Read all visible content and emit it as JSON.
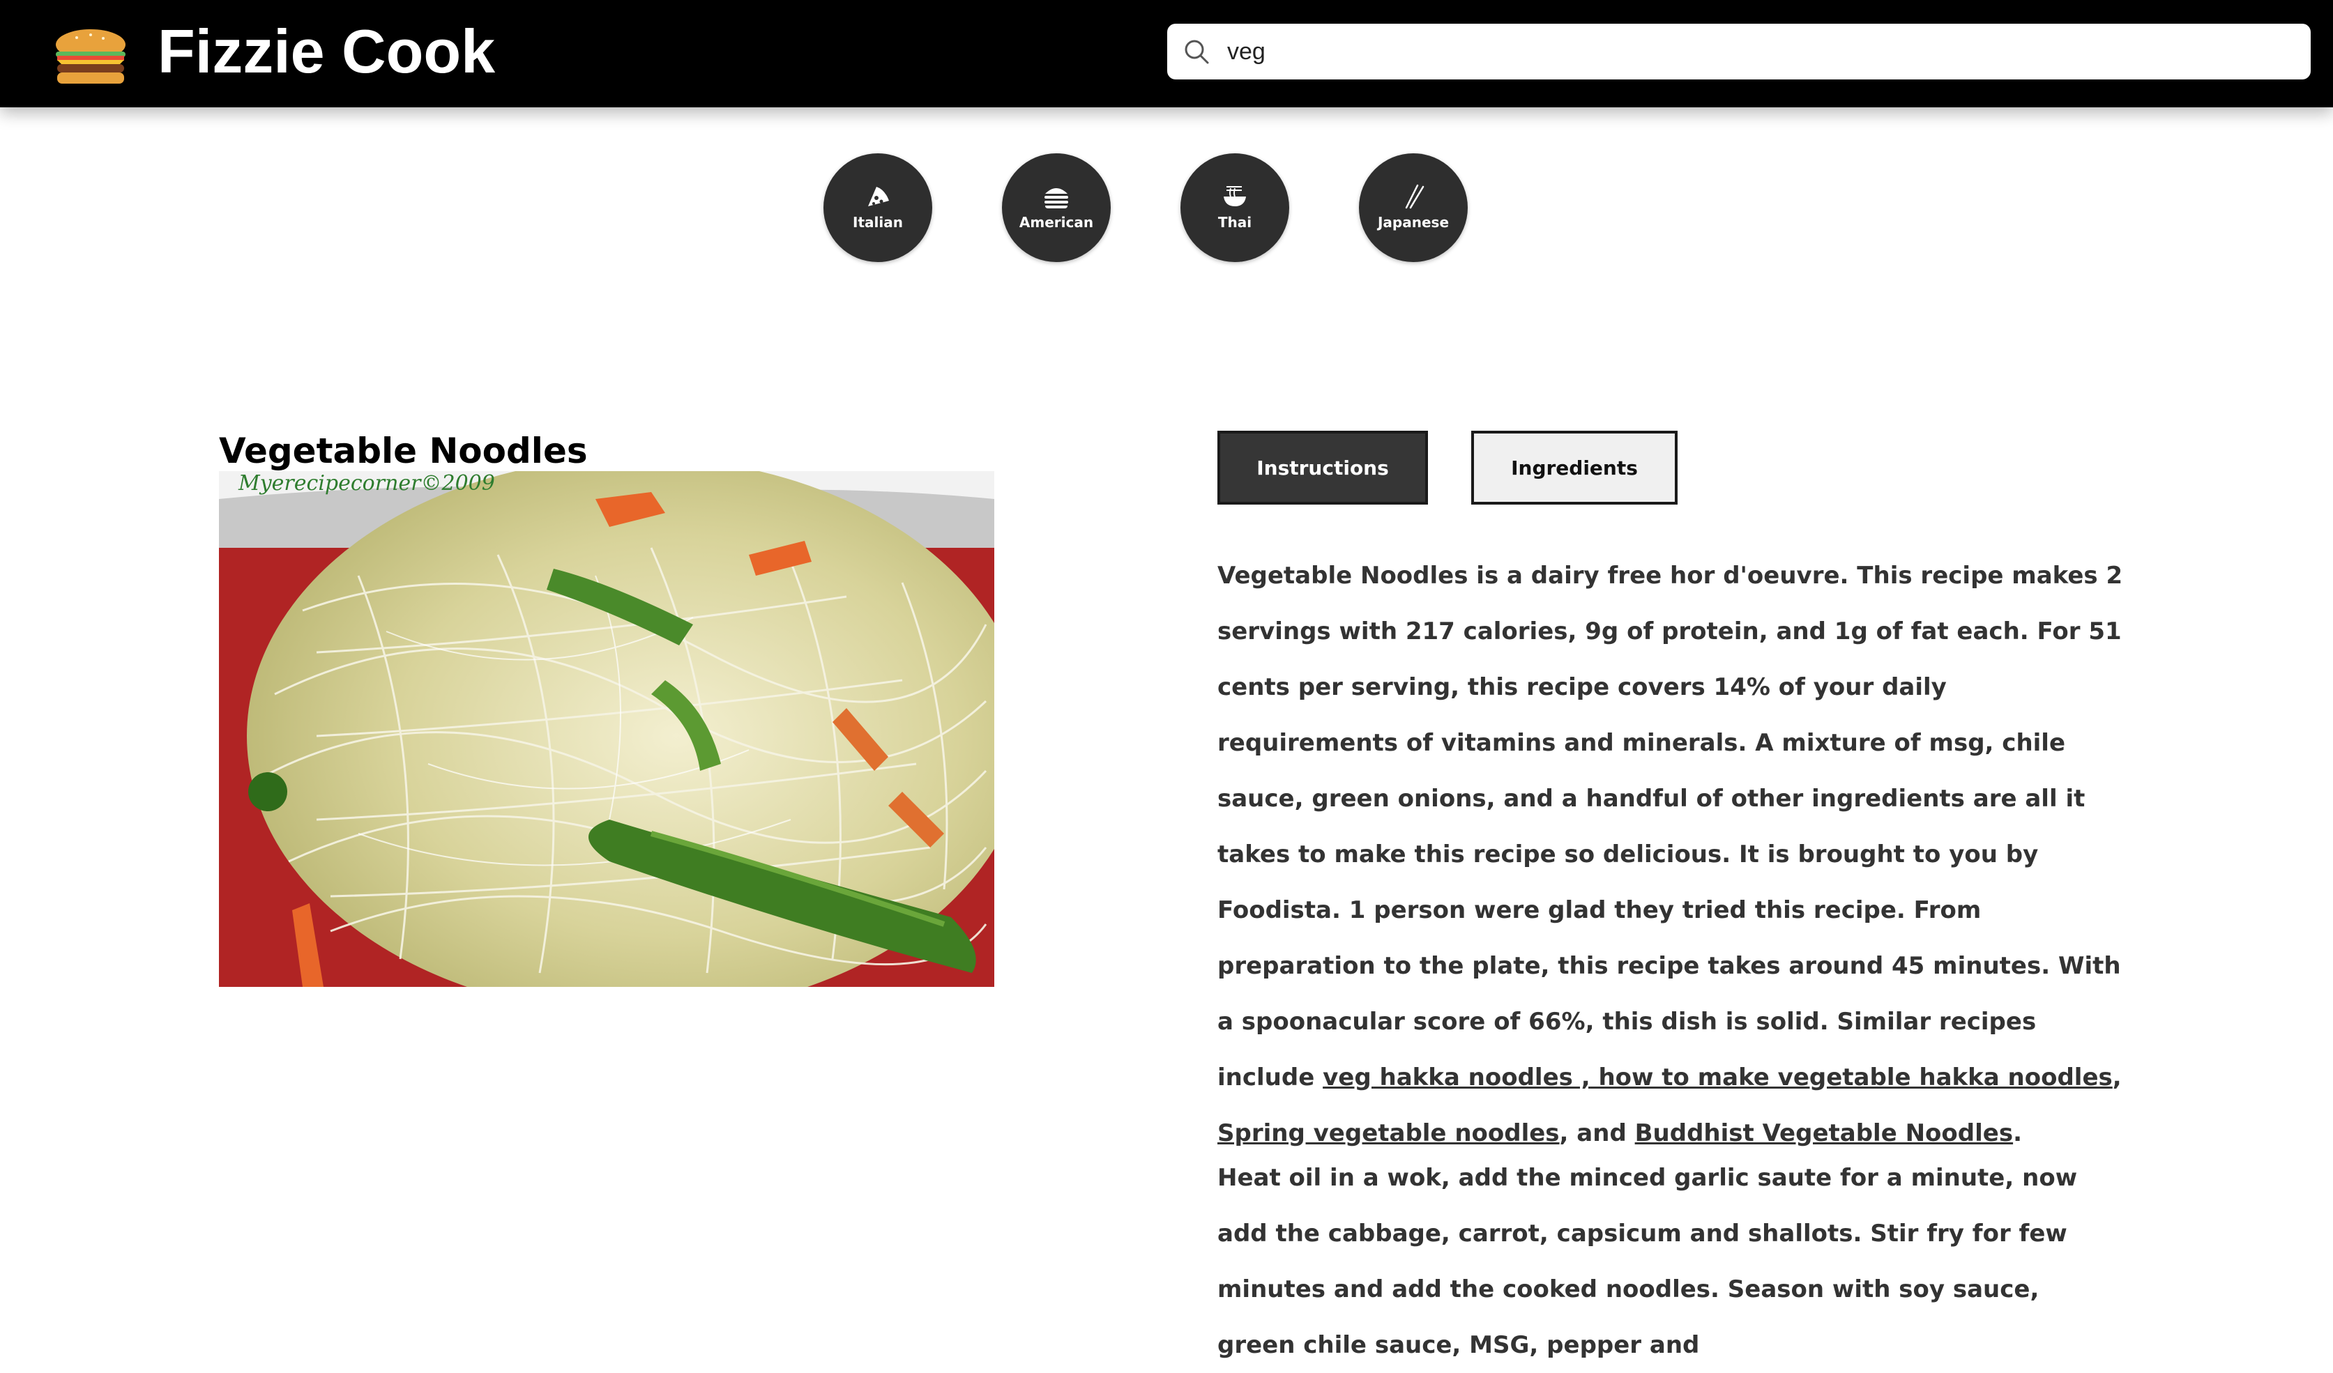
{
  "header": {
    "brand": "Fizzie Cook",
    "logo_icon": "burger-icon",
    "search": {
      "icon": "search-icon",
      "value": "veg"
    }
  },
  "categories": [
    {
      "label": "Italian",
      "icon": "pizza-icon"
    },
    {
      "label": "American",
      "icon": "burger-icon"
    },
    {
      "label": "Thai",
      "icon": "noodle-bowl-icon"
    },
    {
      "label": "Japanese",
      "icon": "chopsticks-icon"
    }
  ],
  "recipe": {
    "title": "Vegetable Noodles",
    "image_watermark": "Myerecipecorner©2009",
    "tabs": {
      "instructions": "Instructions",
      "ingredients": "Ingredients",
      "active": "Instructions"
    },
    "summary": {
      "text_1": "Vegetable Noodles is a dairy free hor d'oeuvre. This recipe makes 2 servings with 217 calories, 9g of protein, and 1g of fat each. For 51 cents per serving, this recipe covers 14% of your daily requirements of vitamins and minerals. A mixture of msg, chile sauce, green onions, and a handful of other ingredients are all it takes to make this recipe so delicious. It is brought to you by Foodista. 1 person were glad they tried this recipe. From preparation to the plate, this recipe takes around 45 minutes. With a spoonacular score of 66%, this dish is solid. Similar recipes include ",
      "link_1": "veg hakka noodles , how to make vegetable hakka noodles",
      "sep_1": ", ",
      "link_2": "Spring vegetable noodles",
      "sep_2": ", and ",
      "link_3": "Buddhist Vegetable Noodles",
      "end": "."
    },
    "instructions_text": "Heat oil in a wok, add the minced garlic saute for a minute, now add the cabbage, carrot, capsicum and shallots. Stir fry for few minutes and add the cooked noodles. Season with soy sauce, green chile sauce, MSG, pepper and"
  },
  "colors": {
    "header_bg": "#000000",
    "category_bg": "#2e2e2e",
    "active_tab_bg": "#363636",
    "inactive_tab_bg": "#f0f0f0",
    "body_text": "#333333"
  }
}
